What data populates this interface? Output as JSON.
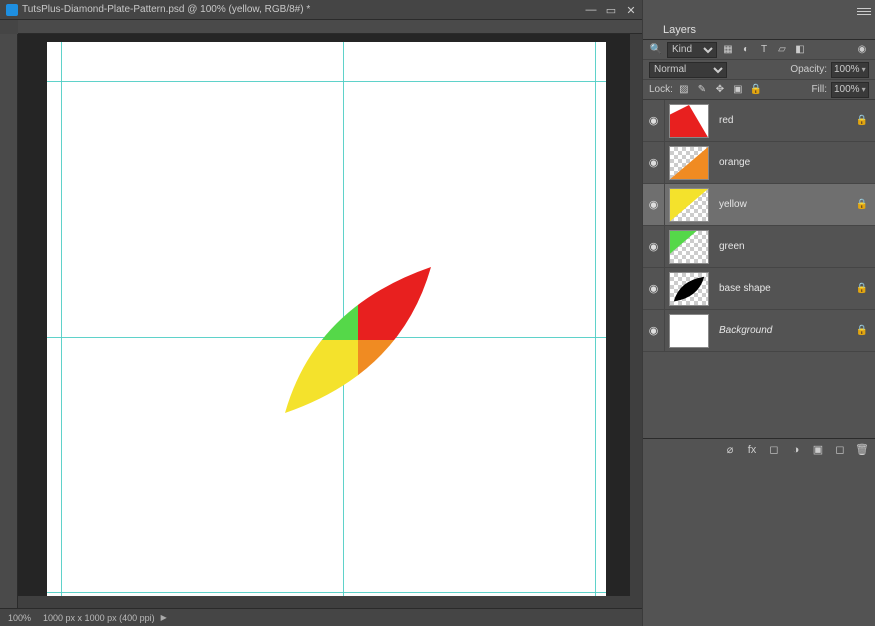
{
  "document": {
    "title": "TutsPlus-Diamond-Plate-Pattern.psd @ 100% (yellow, RGB/8#) *",
    "zoom": "100%",
    "dimensions": "1000 px x 1000 px (400 ppi)"
  },
  "guides": {
    "h1_pct": 7.0,
    "h2_pct": 53.0,
    "h3_pct": 99.0,
    "v1_pct": 2.5,
    "v2_pct": 53.0,
    "v3_pct": 98.0
  },
  "leaf": {
    "colors": {
      "red": "#e8201f",
      "orange": "#f08b22",
      "yellow": "#f4e22c",
      "green": "#55d849"
    }
  },
  "layers_panel": {
    "tab": "Layers",
    "filter_label": "Kind",
    "blend_mode": "Normal",
    "opacity_label": "Opacity:",
    "opacity_value": "100%",
    "lock_label": "Lock:",
    "fill_label": "Fill:",
    "fill_value": "100%",
    "layers": [
      {
        "name": "red",
        "visible": true,
        "locked": true,
        "selected": false,
        "italic": false,
        "thumb": "red"
      },
      {
        "name": "orange",
        "visible": true,
        "locked": false,
        "selected": false,
        "italic": false,
        "thumb": "orange"
      },
      {
        "name": "yellow",
        "visible": true,
        "locked": true,
        "selected": true,
        "italic": false,
        "thumb": "yellow"
      },
      {
        "name": "green",
        "visible": true,
        "locked": false,
        "selected": false,
        "italic": false,
        "thumb": "green"
      },
      {
        "name": "base shape",
        "visible": true,
        "locked": true,
        "selected": false,
        "italic": false,
        "thumb": "black"
      },
      {
        "name": "Background",
        "visible": true,
        "locked": true,
        "selected": false,
        "italic": true,
        "thumb": "white"
      }
    ]
  }
}
